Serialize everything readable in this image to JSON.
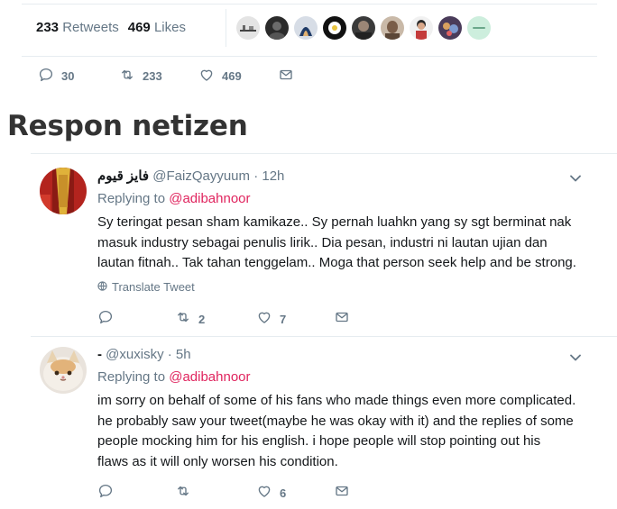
{
  "top_tweet": {
    "retweets_count": "233",
    "retweets_label": "Retweets",
    "likes_count": "469",
    "likes_label": "Likes",
    "liker_avatars": [
      {
        "icon": "liker-avatar-1",
        "color": "#d9d9d9"
      },
      {
        "icon": "liker-avatar-2",
        "color": "#2b2b2b"
      },
      {
        "icon": "liker-avatar-3",
        "color": "#7a9cc6"
      },
      {
        "icon": "liker-avatar-4",
        "color": "#1a1a1a"
      },
      {
        "icon": "liker-avatar-5",
        "color": "#3a3a3a"
      },
      {
        "icon": "liker-avatar-6",
        "color": "#8a6f5c"
      },
      {
        "icon": "liker-avatar-7",
        "color": "#c44a3a"
      },
      {
        "icon": "liker-avatar-8",
        "color": "#6a5a7a"
      },
      {
        "icon": "liker-avatar-9",
        "color": "#bfe6d2"
      }
    ],
    "liker_badge_text": "",
    "actions": {
      "reply_count": "30",
      "retweet_count": "233",
      "like_count": "469"
    }
  },
  "section_heading": "Respon netizen",
  "replies": [
    {
      "display_name": "فايز قيوم",
      "handle": "@FaizQayyuum",
      "time": "· 12h",
      "replying_to_label": "Replying to",
      "replying_to_handle": "@adibahnoor",
      "lines": [
        "Sy teringat pesan sham kamikaze.. Sy pernah luahkn yang sy sgt berminat nak",
        "masuk industry sebagai penulis lirik.. Dia pesan, industri ni lautan ujian dan",
        "lautan fitnah.. Tak tahan tenggelam.. Moga that person seek help and be strong."
      ],
      "translate_label": "Translate Tweet",
      "reply_count": "",
      "retweet_count": "2",
      "like_count": "7"
    },
    {
      "display_name": "-",
      "handle": "@xuxisky",
      "time": "· 5h",
      "replying_to_label": "Replying to",
      "replying_to_handle": "@adibahnoor",
      "lines": [
        "im sorry on behalf of some of his fans who made things even more complicated.",
        "he probably saw your tweet(maybe he was okay with it) and the replies of some",
        "people mocking him for his english. i hope people will stop pointing out his",
        "flaws as it will only worsen his condition."
      ],
      "reply_count": "",
      "retweet_count": "",
      "like_count": "6"
    }
  ],
  "colors": {
    "text_primary": "#14171a",
    "text_secondary": "#657786",
    "mention": "#e0245e",
    "divider": "#e6ecf0",
    "heading": "#333333"
  }
}
